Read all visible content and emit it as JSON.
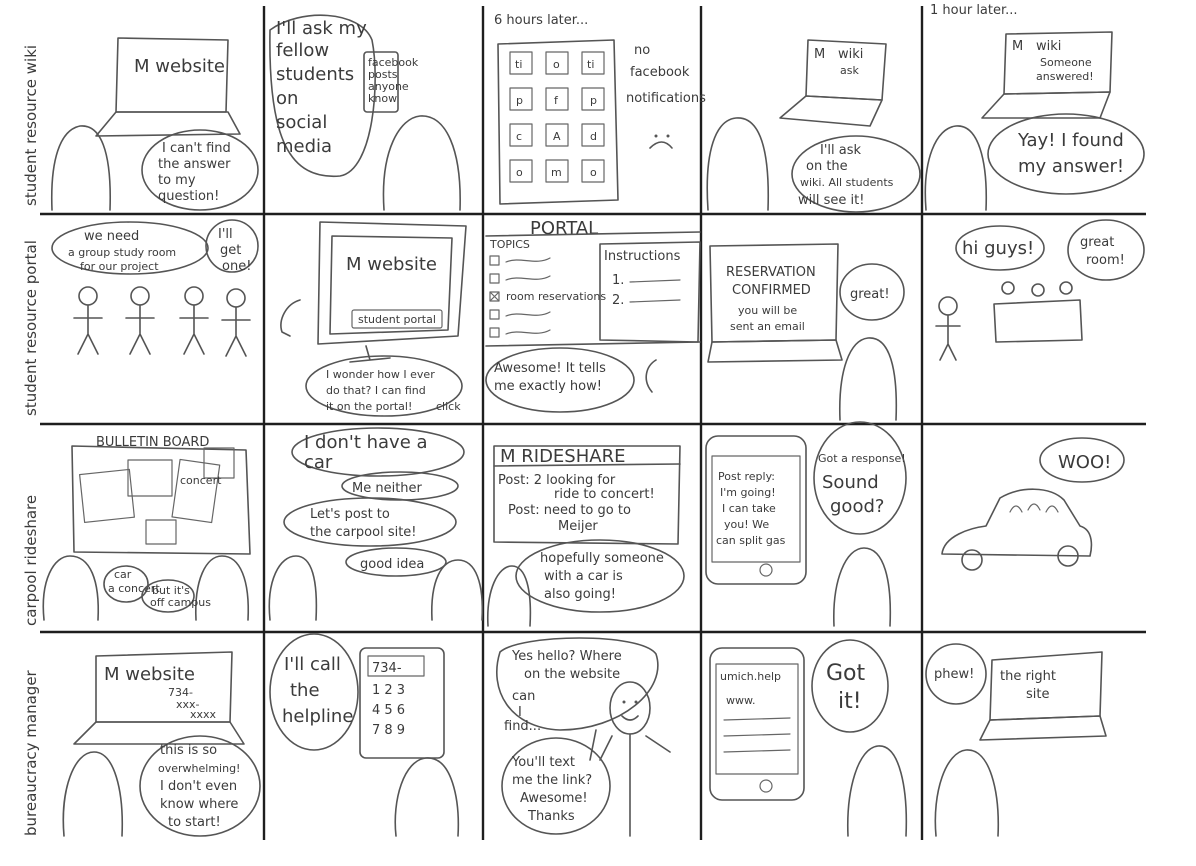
{
  "rows": [
    {
      "label": "student resource wiki",
      "panels": [
        {
          "laptop_screen": "M website",
          "speech": [
            "I can't find",
            "the answer",
            "to my",
            "question!"
          ]
        },
        {
          "speech": [
            "I'll ask my",
            "fellow",
            "students",
            "on",
            "social",
            "media"
          ],
          "phone_lines": [
            "facebook",
            "posts",
            "anyone",
            "know"
          ]
        },
        {
          "caption": "6 hours later...",
          "note": [
            "no",
            "facebook",
            "notifications"
          ],
          "app_icons": [
            "ti",
            "o",
            "ti",
            "p",
            "f",
            "p",
            "c",
            "A",
            "d",
            "o",
            "m",
            "o"
          ]
        },
        {
          "laptop_screen": [
            "M",
            "wiki",
            "ask"
          ],
          "speech": [
            "I'll ask",
            "on the",
            "wiki. All students",
            "will see it!"
          ]
        },
        {
          "caption": "1 hour later...",
          "laptop_screen": [
            "M",
            "wiki",
            "Someone",
            "answered!"
          ],
          "speech": [
            "Yay! I found",
            "my answer!"
          ]
        }
      ]
    },
    {
      "label": "student resource portal",
      "panels": [
        {
          "speech_left": [
            "we need",
            "a group study room",
            "for our project"
          ],
          "speech_right": [
            "I'll",
            "get",
            "one!"
          ]
        },
        {
          "monitor_screen": "M website",
          "button": "student portal",
          "speech": [
            "I wonder how I ever",
            "do that? I can find",
            "it on the portal!"
          ],
          "click": "click"
        },
        {
          "title": "PORTAL",
          "topics_label": "TOPICS",
          "topic_item": "room reservations",
          "instructions_label": "Instructions",
          "steps": [
            "1.",
            "2."
          ],
          "speech": [
            "Awesome! It tells",
            "me exactly how!"
          ]
        },
        {
          "screen": [
            "RESERVATION",
            "CONFIRMED",
            "you will be",
            "sent an email"
          ],
          "speech": "great!"
        },
        {
          "speech_left": "hi guys!",
          "speech_right": [
            "great",
            "room!"
          ]
        }
      ]
    },
    {
      "label": "carpool rideshare",
      "panels": [
        {
          "title": "BULLETIN BOARD",
          "note": "concert",
          "speech_left": [
            "car",
            "a concert"
          ],
          "speech_right": [
            "but it's",
            "off campus"
          ]
        },
        {
          "speech": [
            "I don't have a",
            "car"
          ],
          "speech_2": "Me neither",
          "speech_3": [
            "Let's post to",
            "the carpool site!"
          ],
          "speech_4": "good idea"
        },
        {
          "title": "M RIDESHARE",
          "posts": [
            "Post: 2 looking for",
            "ride to concert!",
            "Post: need to go to",
            "Meijer"
          ],
          "speech": [
            "hopefully someone",
            "with a car is",
            "also going!"
          ]
        },
        {
          "phone": [
            "Post reply:",
            "I'm going!",
            "I can take",
            "you! We",
            "can split gas"
          ],
          "speech": [
            "Got a response!",
            "Sound",
            "good?"
          ]
        },
        {
          "speech": "WOO!"
        }
      ]
    },
    {
      "label": "bureaucracy manager",
      "panels": [
        {
          "laptop_screen": [
            "M website",
            "734-",
            "xxx-",
            "xxxx"
          ],
          "speech": [
            "this is so",
            "overwhelming!",
            "I don't even",
            "know where",
            "to start!"
          ]
        },
        {
          "speech": [
            "I'll call",
            "the",
            "helpline"
          ],
          "phone_display": "734-",
          "keypad": [
            "1 2 3",
            "4 5 6",
            "7 8 9"
          ]
        },
        {
          "speech": [
            "Yes hello? Where",
            "on the website",
            "can",
            "I",
            "find..."
          ],
          "speech_2": [
            "You'll text",
            "me the link?",
            "Awesome!",
            "Thanks"
          ]
        },
        {
          "phone": [
            "umich.help",
            "www."
          ],
          "speech": [
            "Got",
            "it!"
          ]
        },
        {
          "speech_left": "phew!",
          "laptop_screen": [
            "the right",
            "site"
          ]
        }
      ]
    }
  ]
}
